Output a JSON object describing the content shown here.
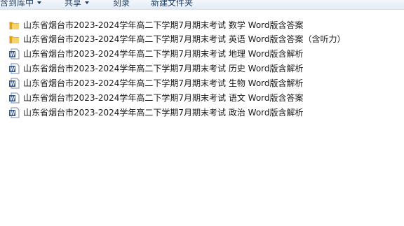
{
  "toolbar": {
    "library_label": "含到库中",
    "share_label": "共享",
    "burn_label": "刻录",
    "new_folder_label": "新建文件夹"
  },
  "files": [
    {
      "name": "山东省烟台市2023-2024学年高二下学期7月期末考试  数学  Word版含答案",
      "icon": "folder-icon"
    },
    {
      "name": "山东省烟台市2023-2024学年高二下学期7月期末考试  英语  Word版含答案（含听力）",
      "icon": "folder-icon"
    },
    {
      "name": "山东省烟台市2023-2024学年高二下学期7月期末考试 地理 Word版含解析",
      "icon": "word-doc-icon"
    },
    {
      "name": "山东省烟台市2023-2024学年高二下学期7月期末考试 历史 Word版含解析",
      "icon": "word-doc-icon"
    },
    {
      "name": "山东省烟台市2023-2024学年高二下学期7月期末考试 生物  Word版含解析",
      "icon": "word-doc-icon"
    },
    {
      "name": "山东省烟台市2023-2024学年高二下学期7月期末考试 语文 Word版含答案",
      "icon": "word-doc-icon"
    },
    {
      "name": "山东省烟台市2023-2024学年高二下学期7月期末考试 政治 Word版含解析",
      "icon": "word-doc-icon"
    }
  ]
}
